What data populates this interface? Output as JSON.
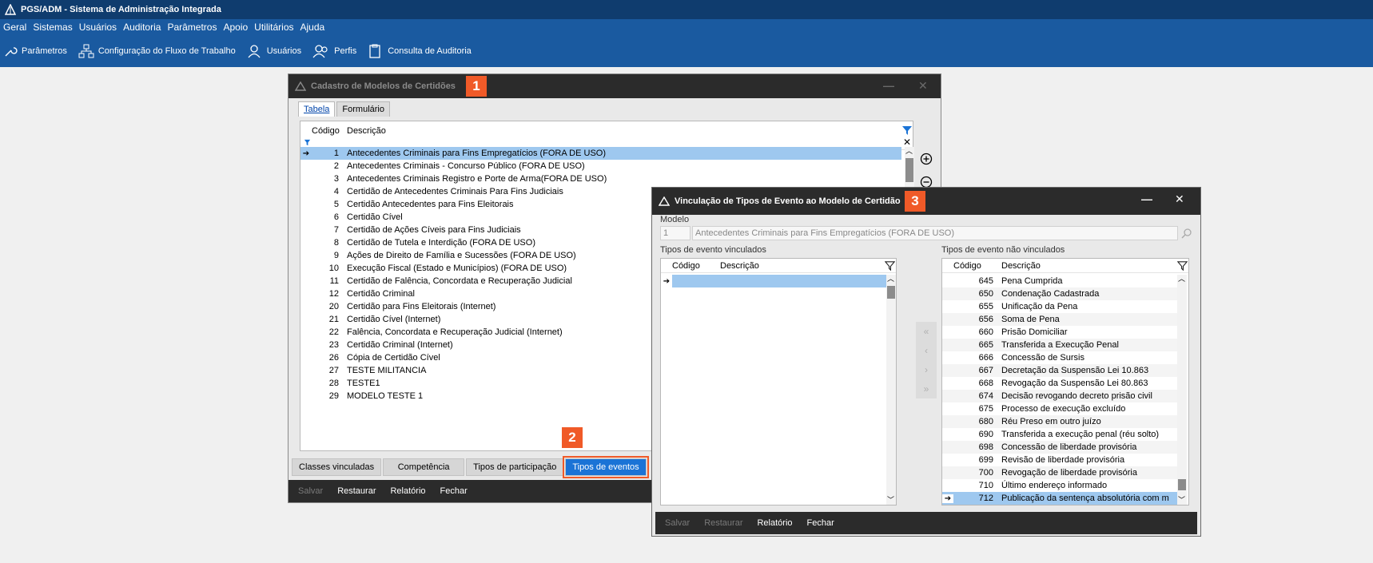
{
  "app": {
    "title": "PGS/ADM - Sistema de Administração Integrada",
    "menu": [
      "Geral",
      "Sistemas",
      "Usuários",
      "Auditoria",
      "Parâmetros",
      "Apoio",
      "Utilitários",
      "Ajuda"
    ],
    "toolbar": [
      {
        "label": "Parâmetros",
        "icon": "wrench-icon"
      },
      {
        "label": "Configuração do Fluxo de Trabalho",
        "icon": "workflow-icon"
      },
      {
        "label": "Usuários",
        "icon": "user-icon"
      },
      {
        "label": "Perfis",
        "icon": "profiles-icon"
      },
      {
        "label": "Consulta de Auditoria",
        "icon": "audit-icon"
      }
    ]
  },
  "window1": {
    "title": "Cadastro de Modelos de Certidões",
    "badge": "1",
    "tabs": [
      "Tabela",
      "Formulário"
    ],
    "columns": {
      "code": "Código",
      "desc": "Descrição"
    },
    "rows": [
      {
        "code": "1",
        "desc": "Antecedentes Criminais para Fins Empregatícios (FORA DE USO)"
      },
      {
        "code": "2",
        "desc": "Antecedentes Criminais - Concurso Público (FORA DE USO)"
      },
      {
        "code": "3",
        "desc": "Antecedentes Criminais Registro e Porte de Arma(FORA DE USO)"
      },
      {
        "code": "4",
        "desc": "Certidão de Antecedentes Criminais Para Fins Judiciais"
      },
      {
        "code": "5",
        "desc": "Certidão Antecedentes para Fins Eleitorais"
      },
      {
        "code": "6",
        "desc": "Certidão Cível"
      },
      {
        "code": "7",
        "desc": "Certidão de Ações Cíveis para Fins Judiciais"
      },
      {
        "code": "8",
        "desc": "Certidão de Tutela e Interdição (FORA DE USO)"
      },
      {
        "code": "9",
        "desc": "Ações de Direito de Família e Sucessões (FORA DE USO)"
      },
      {
        "code": "10",
        "desc": "Execução Fiscal (Estado e Municípios) (FORA DE USO)"
      },
      {
        "code": "11",
        "desc": "Certidão de Falência, Concordata e Recuperação Judicial"
      },
      {
        "code": "12",
        "desc": "Certidão Criminal"
      },
      {
        "code": "20",
        "desc": "Certidão para Fins Eleitorais (Internet)"
      },
      {
        "code": "21",
        "desc": "Certidão Cível (Internet)"
      },
      {
        "code": "22",
        "desc": "Falência, Concordata e Recuperação Judicial (Internet)"
      },
      {
        "code": "23",
        "desc": "Certidão Criminal (Internet)"
      },
      {
        "code": "26",
        "desc": "Cópia de Certidão Cível"
      },
      {
        "code": "27",
        "desc": "TESTE MILITANCIA"
      },
      {
        "code": "28",
        "desc": "TESTE1"
      },
      {
        "code": "29",
        "desc": "MODELO TESTE 1"
      }
    ],
    "bottom_tabs": [
      "Classes vinculadas",
      "Competência",
      "Tipos de participação",
      "Tipos de eventos"
    ],
    "badge2": "2",
    "actions": [
      "Salvar",
      "Restaurar",
      "Relatório",
      "Fechar"
    ]
  },
  "window3": {
    "title": "Vinculação de Tipos de Evento ao Modelo de Certidão",
    "badge": "3",
    "model_label": "Modelo",
    "model_code": "1",
    "model_desc": "Antecedentes Criminais para Fins Empregatícios (FORA DE USO)",
    "linked_label": "Tipos de evento vinculados",
    "unlinked_label": "Tipos de evento não vinculados",
    "columns": {
      "code": "Código",
      "desc": "Descrição"
    },
    "unlinked_rows": [
      {
        "code": "645",
        "desc": "Pena Cumprida"
      },
      {
        "code": "650",
        "desc": "Condenação Cadastrada"
      },
      {
        "code": "655",
        "desc": "Unificação da Pena"
      },
      {
        "code": "656",
        "desc": "Soma de Pena"
      },
      {
        "code": "660",
        "desc": "Prisão Domiciliar"
      },
      {
        "code": "665",
        "desc": "Transferida a Execução Penal"
      },
      {
        "code": "666",
        "desc": "Concessão de Sursis"
      },
      {
        "code": "667",
        "desc": "Decretação da Suspensão Lei 10.863"
      },
      {
        "code": "668",
        "desc": "Revogação da Suspensão Lei 80.863"
      },
      {
        "code": "674",
        "desc": "Decisão revogando decreto prisão civil"
      },
      {
        "code": "675",
        "desc": "Processo de execução excluído"
      },
      {
        "code": "680",
        "desc": "Réu Preso em outro juízo"
      },
      {
        "code": "690",
        "desc": "Transferida a execução penal (réu solto)"
      },
      {
        "code": "698",
        "desc": "Concessão de liberdade provisória"
      },
      {
        "code": "699",
        "desc": "Revisão de liberdade provisória"
      },
      {
        "code": "700",
        "desc": "Revogação de liberdade provisória"
      },
      {
        "code": "710",
        "desc": "Último endereço informado"
      },
      {
        "code": "712",
        "desc": "Publicação da sentença absolutória com m"
      }
    ],
    "actions": [
      "Salvar",
      "Restaurar",
      "Relatório",
      "Fechar"
    ]
  },
  "colors": {
    "titlebar": "#0f3c6e",
    "menubar": "#1a5aa0",
    "badge": "#f05a28",
    "selection": "#9ec8ef",
    "active_tab": "#1a73d6"
  }
}
